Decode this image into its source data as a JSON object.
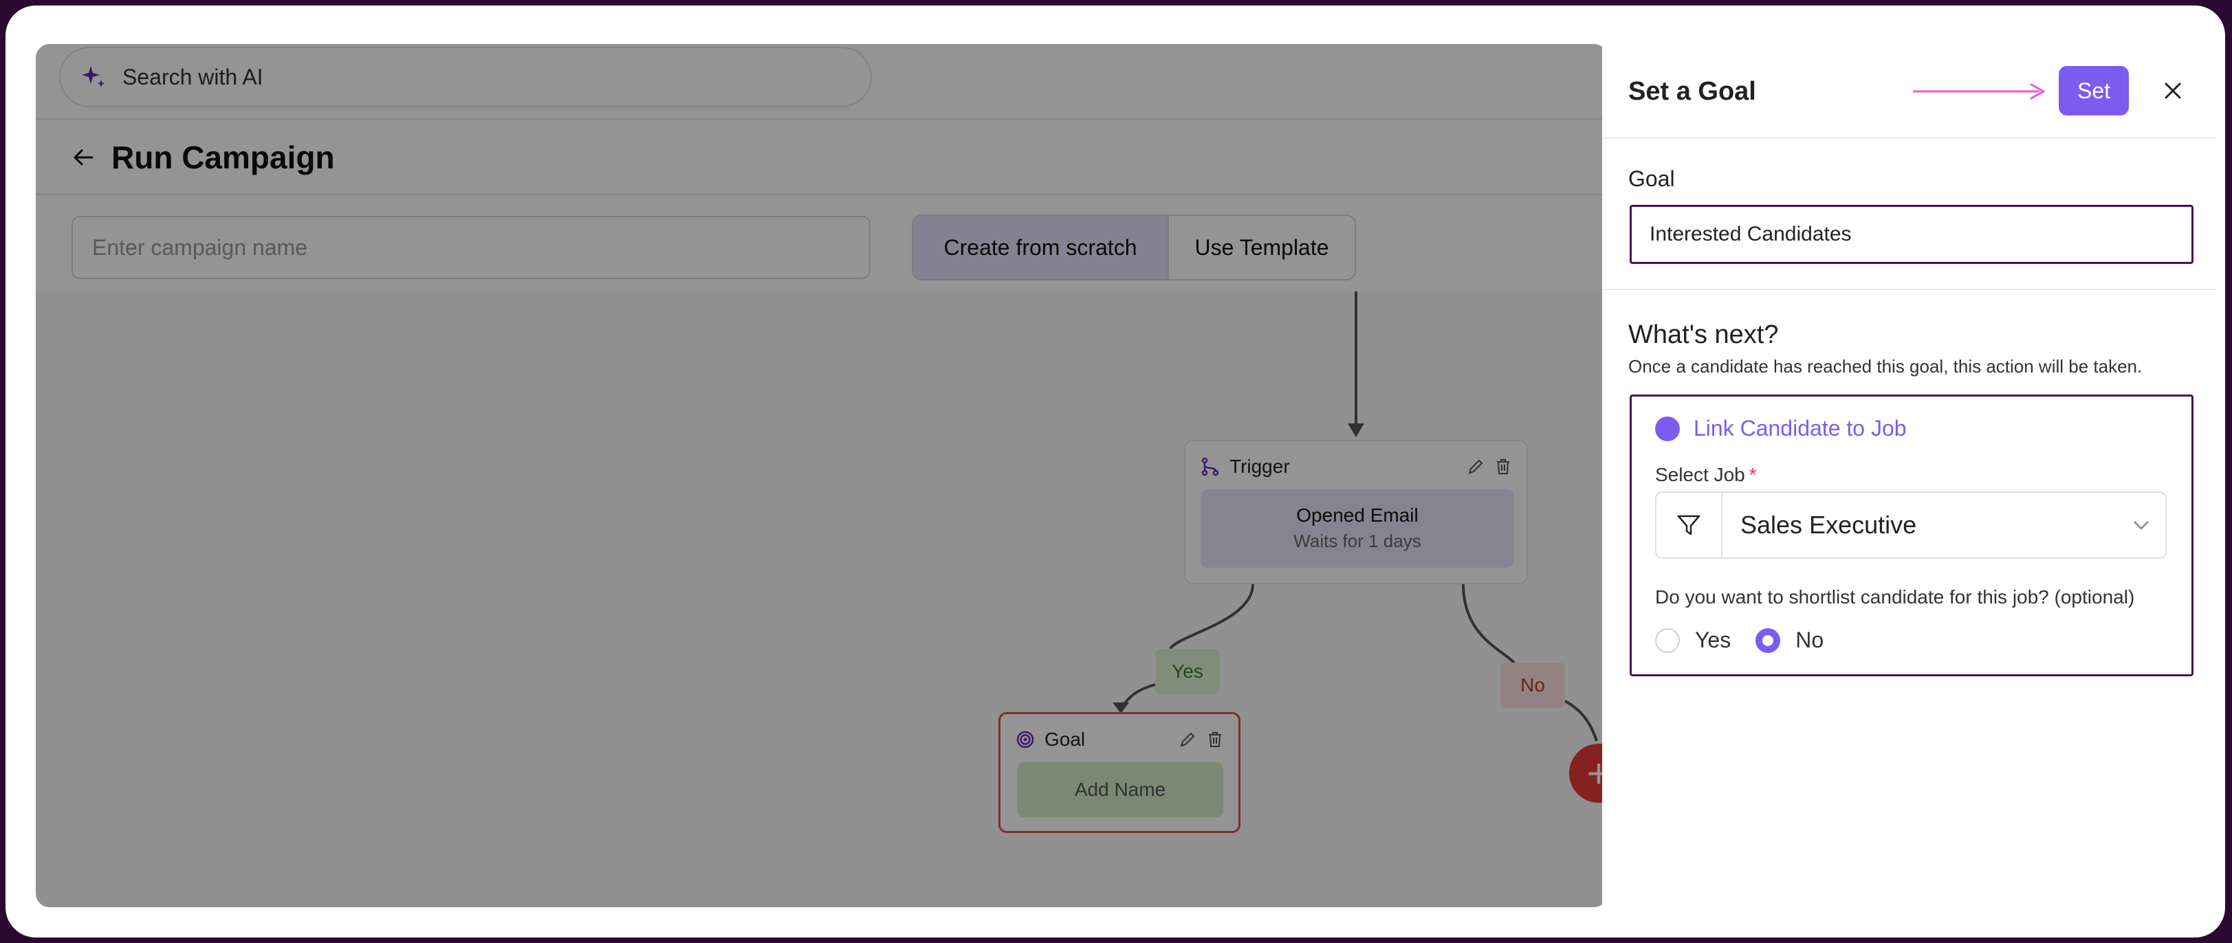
{
  "search": {
    "placeholder": "Search with AI"
  },
  "header": {
    "title": "Run Campaign"
  },
  "campaign": {
    "name_placeholder": "Enter campaign name"
  },
  "mode_toggle": {
    "create_label": "Create from scratch",
    "template_label": "Use Template"
  },
  "flow": {
    "trigger": {
      "title": "Trigger",
      "event": "Opened Email",
      "wait": "Waits for 1 days"
    },
    "yes_label": "Yes",
    "no_label": "No",
    "goal": {
      "title": "Goal",
      "name_placeholder": "Add Name"
    },
    "add_symbol": "+"
  },
  "panel": {
    "title": "Set a Goal",
    "set_label": "Set",
    "goal_label": "Goal",
    "goal_value": "Interested Candidates",
    "next_title": "What's next?",
    "next_desc": "Once a candidate has reached this goal, this action will be taken.",
    "action_label": "Link Candidate to Job",
    "select_job_label": "Select Job",
    "required_mark": "*",
    "selected_job": "Sales Executive",
    "shortlist_question": "Do you want to shortlist candidate for this job? (optional)",
    "shortlist_yes": "Yes",
    "shortlist_no": "No",
    "shortlist_selected": "No"
  },
  "colors": {
    "accent": "#7c5cf0",
    "highlight_border": "#4a0f5c",
    "annotation_arrow": "#e95ad6",
    "goal_border": "#d9534f",
    "add_button": "#e53935"
  },
  "icons": {
    "search": "sparkle-icon",
    "back": "arrow-left-icon",
    "trigger": "branch-icon",
    "goal": "target-icon",
    "edit": "pencil-icon",
    "delete": "trash-icon",
    "close": "close-icon",
    "filter": "filter-icon",
    "dropdown": "chevron-down-icon"
  }
}
